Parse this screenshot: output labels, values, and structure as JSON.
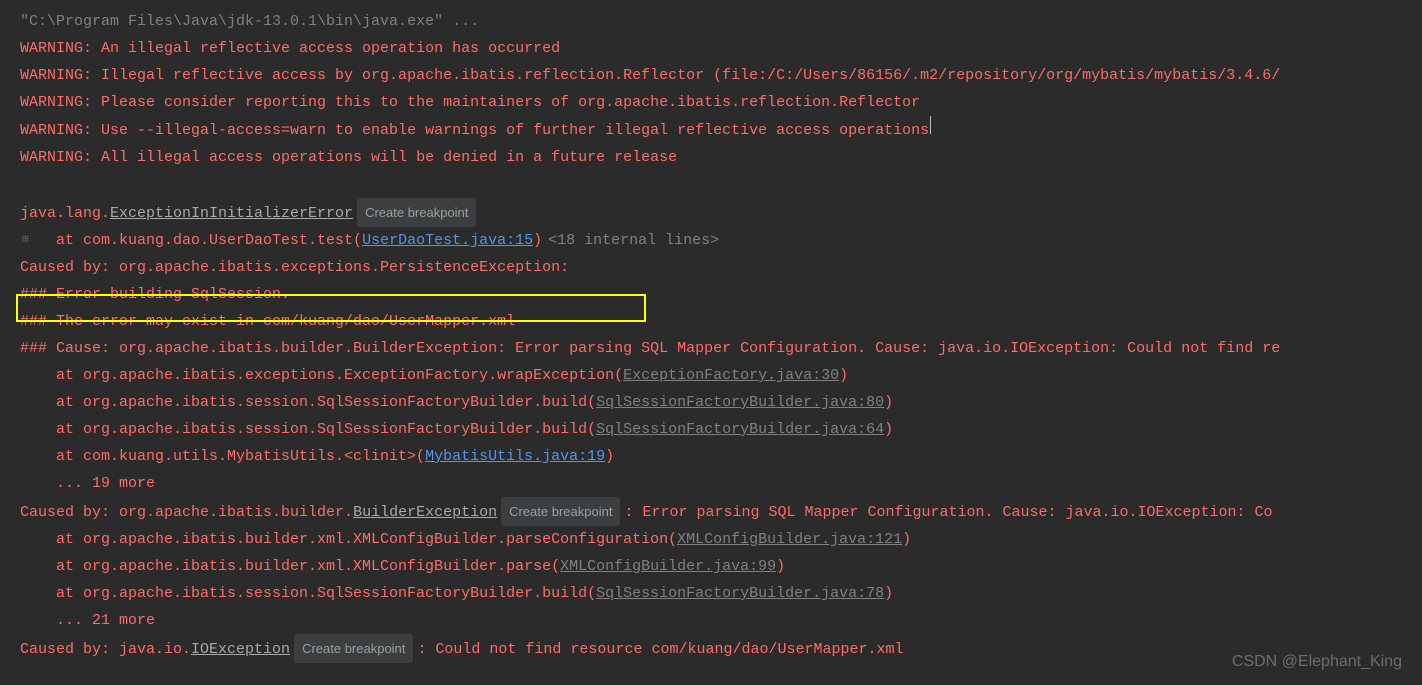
{
  "console": {
    "javaCmd": "\"C:\\Program Files\\Java\\jdk-13.0.1\\bin\\java.exe\" ...",
    "warnings": [
      "WARNING: An illegal reflective access operation has occurred",
      "WARNING: Illegal reflective access by org.apache.ibatis.reflection.Reflector (file:/C:/Users/86156/.m2/repository/org/mybatis/mybatis/3.4.6/",
      "WARNING: Please consider reporting this to the maintainers of org.apache.ibatis.reflection.Reflector",
      "WARNING: Use --illegal-access=warn to enable warnings of further illegal reflective access operations",
      "WARNING: All illegal access operations will be denied in a future release"
    ],
    "exception": {
      "prefix": "java.lang.",
      "name": "ExceptionInInitializerError",
      "createBreakpoint": "Create breakpoint",
      "stackLine": {
        "prefix": "at com.kuang.dao.UserDaoTest.test(",
        "link": "UserDaoTest.java:15",
        "suffix": ")",
        "internal": "<18 internal lines>"
      }
    },
    "causedBy1": "Caused by: org.apache.ibatis.exceptions.PersistenceException: ",
    "errorBuilding": "### Error building SqlSession.",
    "highlightedError": "### The error may exist in com/kuang/dao/UserMapper.xml",
    "causeLine": "### Cause: org.apache.ibatis.builder.BuilderException: Error parsing SQL Mapper Configuration. Cause: java.io.IOException: Could not find re",
    "stack1": {
      "prefix": "at org.apache.ibatis.exceptions.ExceptionFactory.wrapException(",
      "link": "ExceptionFactory.java:30",
      "suffix": ")"
    },
    "stack2": {
      "prefix": "at org.apache.ibatis.session.SqlSessionFactoryBuilder.build(",
      "link": "SqlSessionFactoryBuilder.java:80",
      "suffix": ")"
    },
    "stack3": {
      "prefix": "at org.apache.ibatis.session.SqlSessionFactoryBuilder.build(",
      "link": "SqlSessionFactoryBuilder.java:64",
      "suffix": ")"
    },
    "stack4": {
      "prefix": "at com.kuang.utils.MybatisUtils.<clinit>(",
      "link": "MybatisUtils.java:19",
      "suffix": ")"
    },
    "more19": "... 19 more",
    "causedBy2": {
      "prefix": "Caused by: org.apache.ibatis.builder.",
      "name": "BuilderException",
      "createBreakpoint": "Create breakpoint",
      "suffix": ": Error parsing SQL Mapper Configuration. Cause: java.io.IOException: Co"
    },
    "stack5": {
      "prefix": "at org.apache.ibatis.builder.xml.XMLConfigBuilder.parseConfiguration(",
      "link": "XMLConfigBuilder.java:121",
      "suffix": ")"
    },
    "stack6": {
      "prefix": "at org.apache.ibatis.builder.xml.XMLConfigBuilder.parse(",
      "link": "XMLConfigBuilder.java:99",
      "suffix": ")"
    },
    "stack7": {
      "prefix": "at org.apache.ibatis.session.SqlSessionFactoryBuilder.build(",
      "link": "SqlSessionFactoryBuilder.java:78",
      "suffix": ")"
    },
    "more21": "... 21 more",
    "causedBy3": {
      "prefix": "Caused by: java.io.",
      "name": "IOException",
      "createBreakpoint": "Create breakpoint",
      "suffix": ": Could not find resource com/kuang/dao/UserMapper.xml"
    },
    "gutterIcon": "⊞"
  },
  "watermark": "CSDN @Elephant_King"
}
